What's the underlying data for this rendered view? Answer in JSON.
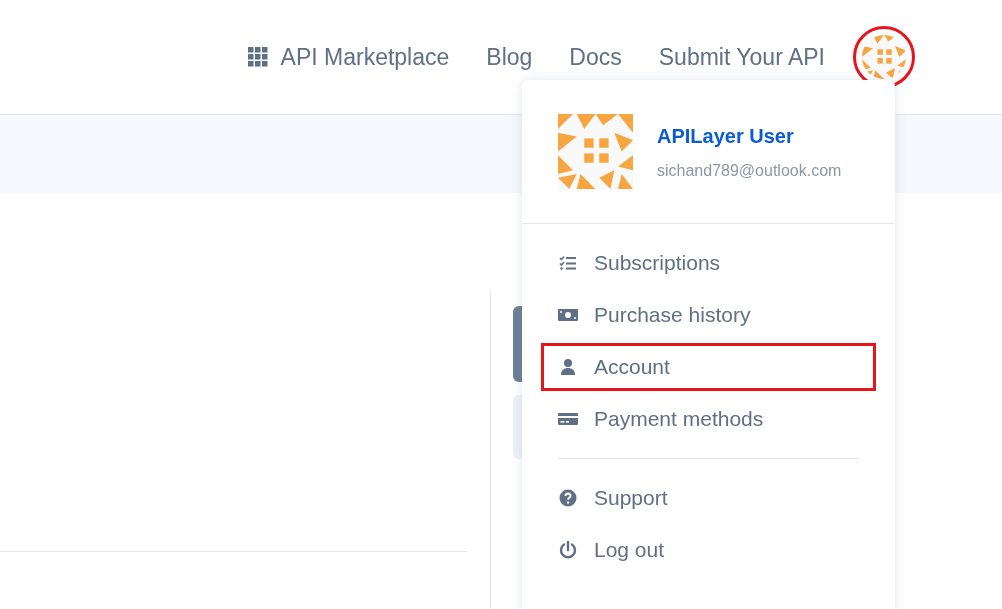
{
  "nav": {
    "links": [
      {
        "label": "API Marketplace",
        "kind": "grid"
      },
      {
        "label": "Blog",
        "kind": "plain"
      },
      {
        "label": "Docs",
        "kind": "plain"
      },
      {
        "label": "Submit Your API",
        "kind": "plain"
      }
    ],
    "avatar": {
      "highlighted": true
    }
  },
  "user_menu": {
    "name": "APILayer User",
    "email": "sichand789@outlook.com",
    "groups": [
      [
        {
          "label": "Subscriptions",
          "kind": "list",
          "highlighted": false
        },
        {
          "label": "Purchase history",
          "kind": "money",
          "highlighted": false
        },
        {
          "label": "Account",
          "kind": "user",
          "highlighted": true
        },
        {
          "label": "Payment methods",
          "kind": "card",
          "highlighted": false
        }
      ],
      [
        {
          "label": "Support",
          "kind": "help",
          "highlighted": false
        },
        {
          "label": "Log out",
          "kind": "power",
          "highlighted": false
        }
      ]
    ]
  }
}
